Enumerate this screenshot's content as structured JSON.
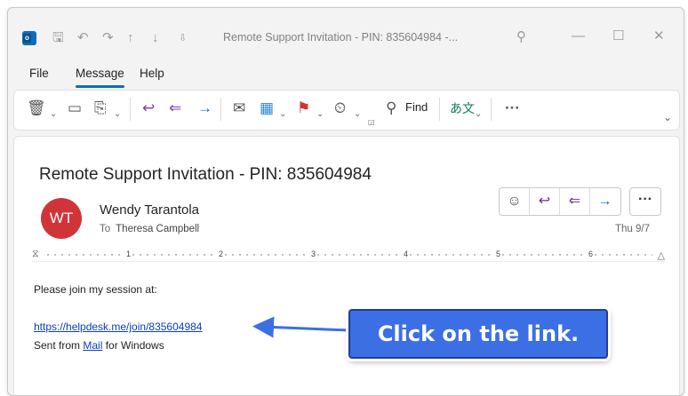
{
  "window": {
    "title": "Remote Support Invitation - PIN: 835604984  -..."
  },
  "menubar": {
    "items": [
      "File",
      "Message",
      "Help"
    ]
  },
  "ribbon": {
    "find_label": "Find"
  },
  "email": {
    "subject": "Remote Support Invitation - PIN: 835604984",
    "sender_initials": "WT",
    "sender_name": "Wendy Tarantola",
    "to_label": "To",
    "recipient": "Theresa Campbell",
    "date": "Thu 9/7",
    "body_line1": "Please join my session at:",
    "link_url": "https://helpdesk.me/join/835604984",
    "sent_prefix": "Sent from ",
    "sent_link": "Mail",
    "sent_suffix": " for Windows"
  },
  "ruler": {
    "numbers": [
      "1",
      "2",
      "3",
      "4",
      "5",
      "6"
    ]
  },
  "callout": {
    "text": "Click on the link."
  },
  "colors": {
    "accent": "#0f6cbd",
    "avatar": "#d13438",
    "callout": "#3c6fe4",
    "link": "#0b3dbd"
  }
}
